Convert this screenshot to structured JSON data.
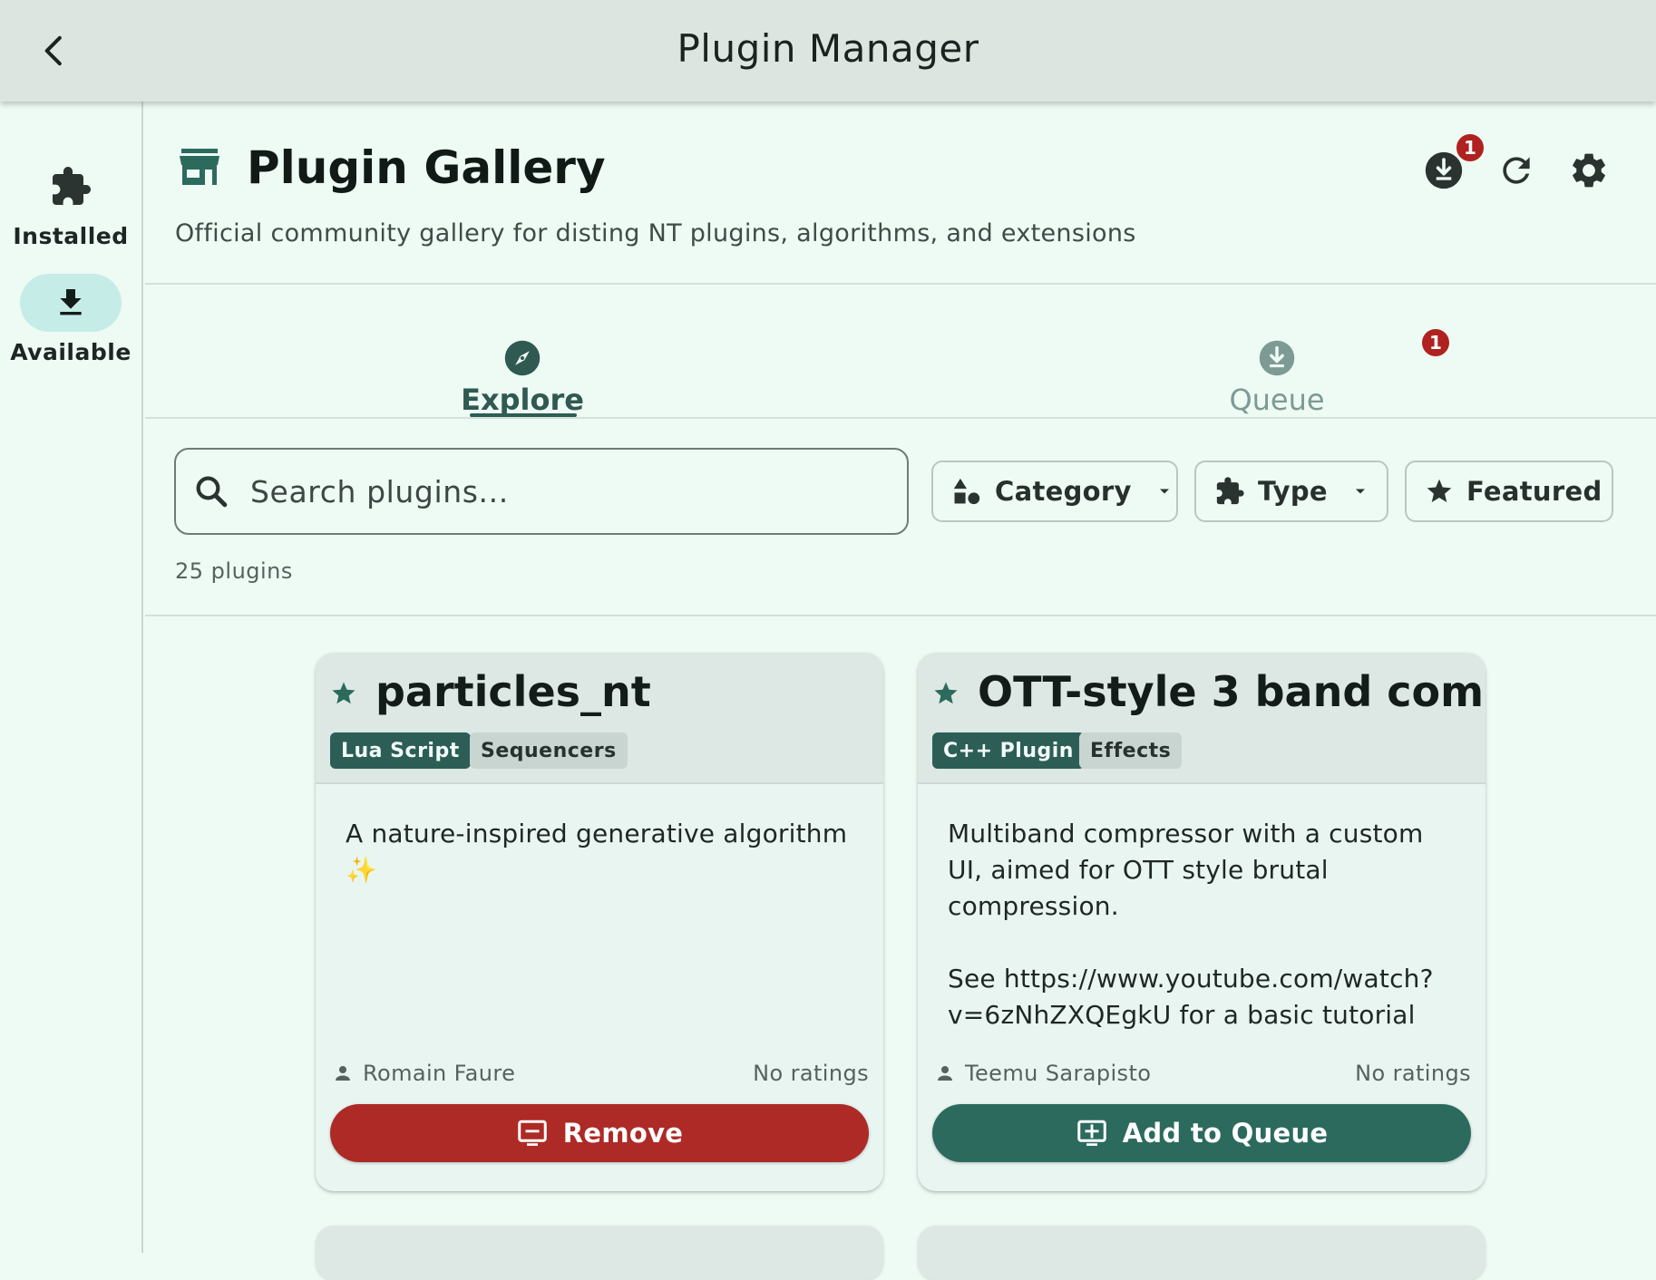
{
  "app": {
    "title": "Plugin Manager",
    "back_icon": "chevron-left-icon"
  },
  "rail": {
    "items": [
      {
        "label": "Installed",
        "icon": "puzzle-icon",
        "active": false
      },
      {
        "label": "Available",
        "icon": "download-icon",
        "active": true
      }
    ]
  },
  "header": {
    "icon": "storefront-icon",
    "title": "Plugin Gallery",
    "subtitle": "Official community gallery for disting NT plugins, algorithms, and extensions",
    "actions": [
      {
        "icon": "download-circle-icon",
        "badge": "1"
      },
      {
        "icon": "refresh-icon"
      },
      {
        "icon": "gear-icon"
      }
    ]
  },
  "tabs": [
    {
      "label": "Explore",
      "icon": "compass-icon",
      "active": true
    },
    {
      "label": "Queue",
      "icon": "download-circle-icon",
      "badge": "1",
      "active": false
    }
  ],
  "search": {
    "placeholder": "Search plugins..."
  },
  "filters": [
    {
      "label": "Category",
      "icon": "shapes-icon",
      "dropdown": true
    },
    {
      "label": "Type",
      "icon": "puzzle-icon",
      "dropdown": true
    },
    {
      "label": "Featured",
      "icon": "star-icon",
      "dropdown": false
    }
  ],
  "results": {
    "count_label": "25 plugins"
  },
  "colors": {
    "accent": "#2c6a5e",
    "danger": "#ad2a26",
    "badge": "#b0221f",
    "background": "#eefaf4"
  },
  "cards": [
    {
      "title": "particles_nt",
      "featured": true,
      "tags": [
        "Lua Script",
        "Sequencers"
      ],
      "description": "A nature-inspired generative algorithm\n✨",
      "author": "Romain Faure",
      "rating": "No ratings",
      "action": {
        "label": "Remove",
        "kind": "remove",
        "icon": "remove-box-icon"
      }
    },
    {
      "title": "OTT-style 3 band com...",
      "featured": true,
      "tags": [
        "C++ Plugin",
        "Effects"
      ],
      "description": "Multiband compressor with a custom UI, aimed for OTT style brutal compression.\n\nSee https://www.youtube.com/watch?v=6zNhZXQEgkU for a basic tutorial",
      "author": "Teemu Sarapisto",
      "rating": "No ratings",
      "action": {
        "label": "Add to Queue",
        "kind": "add",
        "icon": "add-box-icon"
      }
    }
  ]
}
